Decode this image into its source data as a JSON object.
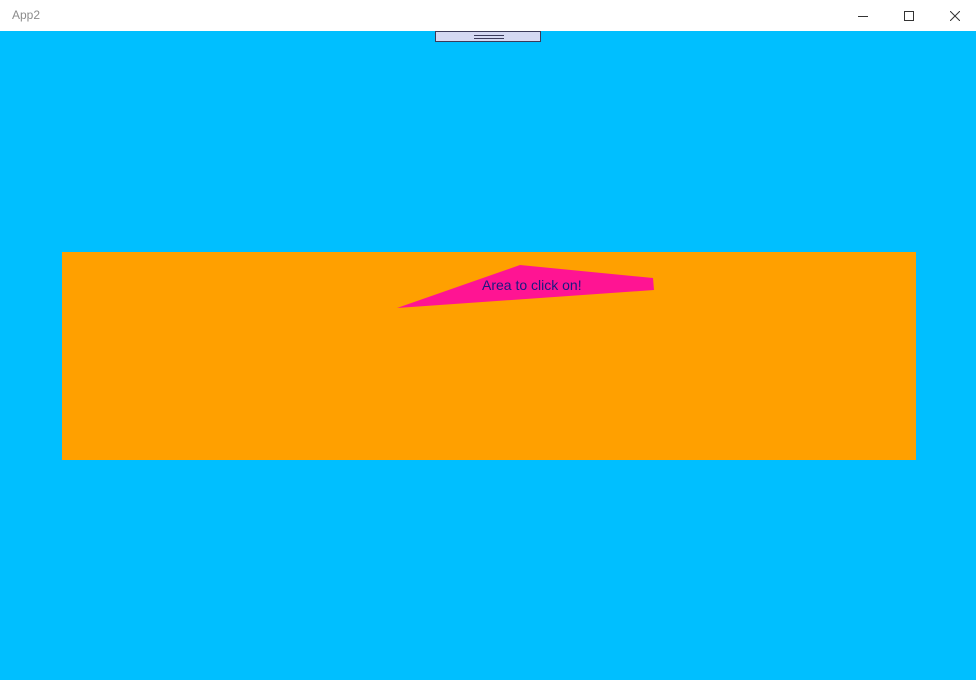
{
  "window": {
    "title": "App2"
  },
  "caption_buttons": {
    "minimize_icon": "minimize-icon",
    "maximize_icon": "maximize-icon",
    "close_icon": "close-icon"
  },
  "colors": {
    "client_background": "#00bfff",
    "panel_background": "#ffa000",
    "shape_fill": "#ff1493",
    "label_text": "#1a1a80",
    "handle_fill": "#d4d8f2"
  },
  "panel": {
    "label": "Area to click on!"
  }
}
